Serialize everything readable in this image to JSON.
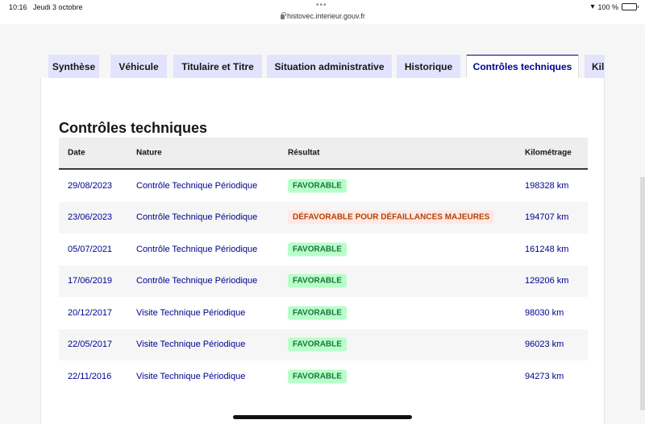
{
  "status_bar": {
    "time": "10:16",
    "date": "Jeudi 3 octobre",
    "url": "histovec.interieur.gouv.fr",
    "battery": "100 %"
  },
  "tabs": [
    {
      "label": "Synthèse",
      "active": false
    },
    {
      "label": "Véhicule",
      "active": false
    },
    {
      "label": "Titulaire et Titre",
      "active": false
    },
    {
      "label": "Situation administrative",
      "active": false
    },
    {
      "label": "Historique",
      "active": false
    },
    {
      "label": "Contrôles techniques",
      "active": true
    },
    {
      "label": "Kilo",
      "active": false
    }
  ],
  "section": {
    "title": "Contrôles techniques"
  },
  "table": {
    "headers": {
      "date": "Date",
      "nature": "Nature",
      "result": "Résultat",
      "km": "Kilométrage"
    },
    "rows": [
      {
        "date": "29/08/2023",
        "nature": "Contrôle Technique Périodique",
        "result": "FAVORABLE",
        "km": "198328 km"
      },
      {
        "date": "23/06/2023",
        "nature": "Contrôle Technique Périodique",
        "result": "DÉFAVORABLE POUR DÉFAILLANCES MAJEURES",
        "km": "194707 km"
      },
      {
        "date": "05/07/2021",
        "nature": "Contrôle Technique Périodique",
        "result": "FAVORABLE",
        "km": "161248 km"
      },
      {
        "date": "17/06/2019",
        "nature": "Contrôle Technique Périodique",
        "result": "FAVORABLE",
        "km": "129206 km"
      },
      {
        "date": "20/12/2017",
        "nature": "Visite Technique Périodique",
        "result": "FAVORABLE",
        "km": "98030 km"
      },
      {
        "date": "22/05/2017",
        "nature": "Visite Technique Périodique",
        "result": "FAVORABLE",
        "km": "96023 km"
      },
      {
        "date": "22/11/2016",
        "nature": "Visite Technique Périodique",
        "result": "FAVORABLE",
        "km": "94273 km"
      }
    ]
  },
  "colors": {
    "accent": "#000091",
    "tab_bg": "#e3e3fd",
    "favorable_bg": "#b8fec9",
    "favorable_text": "#18753c",
    "defavorable_bg": "#ffe9e6",
    "defavorable_text": "#b34000"
  }
}
